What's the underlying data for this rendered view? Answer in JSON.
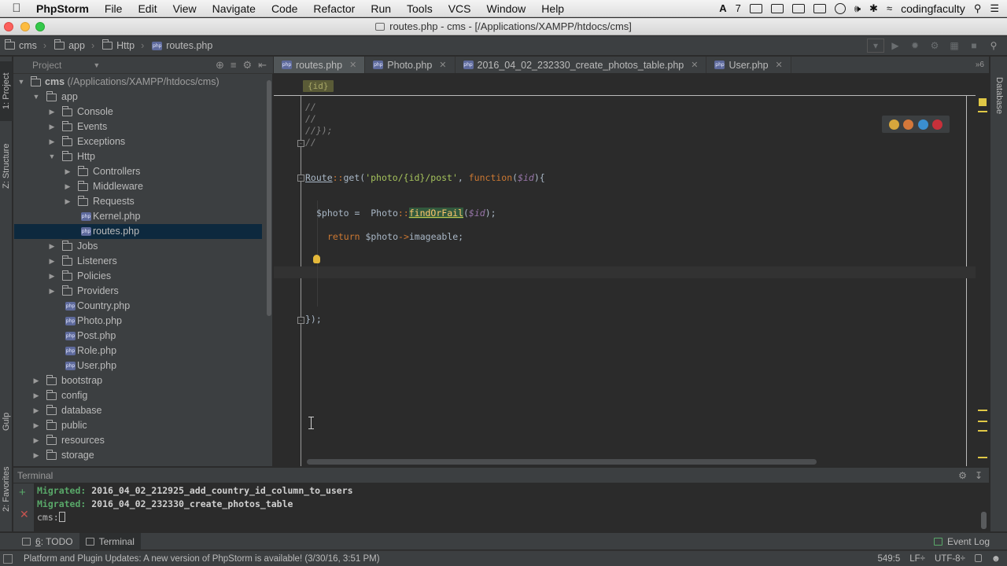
{
  "menubar": {
    "items": [
      "PhpStorm",
      "File",
      "Edit",
      "View",
      "Navigate",
      "Code",
      "Refactor",
      "Run",
      "Tools",
      "VCS",
      "Window",
      "Help"
    ],
    "tray_number": "7",
    "user": "codingfaculty"
  },
  "window": {
    "title": "routes.php - cms - [/Applications/XAMPP/htdocs/cms]"
  },
  "breadcrumb": [
    "cms",
    "app",
    "Http",
    "routes.php"
  ],
  "left_strip": {
    "project": "1: Project",
    "structure": "Z: Structure",
    "gulp": "Gulp",
    "favorites": "2: Favorites"
  },
  "right_strip": {
    "database": "Database"
  },
  "project_panel": {
    "label": "Project",
    "root_name": "cms",
    "root_path": "(/Applications/XAMPP/htdocs/cms)",
    "items": [
      {
        "name": "app"
      },
      {
        "name": "Console"
      },
      {
        "name": "Events"
      },
      {
        "name": "Exceptions"
      },
      {
        "name": "Http"
      },
      {
        "name": "Controllers"
      },
      {
        "name": "Middleware"
      },
      {
        "name": "Requests"
      },
      {
        "name": "Kernel.php"
      },
      {
        "name": "routes.php"
      },
      {
        "name": "Jobs"
      },
      {
        "name": "Listeners"
      },
      {
        "name": "Policies"
      },
      {
        "name": "Providers"
      },
      {
        "name": "Country.php"
      },
      {
        "name": "Photo.php"
      },
      {
        "name": "Post.php"
      },
      {
        "name": "Role.php"
      },
      {
        "name": "User.php"
      },
      {
        "name": "bootstrap"
      },
      {
        "name": "config"
      },
      {
        "name": "database"
      },
      {
        "name": "public"
      },
      {
        "name": "resources"
      },
      {
        "name": "storage"
      }
    ]
  },
  "tabs": [
    {
      "label": "routes.php",
      "active": true
    },
    {
      "label": "Photo.php",
      "active": false
    },
    {
      "label": "2016_04_02_232330_create_photos_table.php",
      "active": false
    },
    {
      "label": "User.php",
      "active": false
    }
  ],
  "tabs_overflow": "»6",
  "editor": {
    "breadcrumb_chip": "{id}",
    "comment_lines": [
      "//",
      "//",
      "//});",
      "//"
    ],
    "route_class": "Route",
    "route_sep": "::",
    "route_method": "get(",
    "route_path": "'photo/{id}/post'",
    "route_comma": ", ",
    "route_function": "function",
    "route_paren_open": "(",
    "route_param": "$id",
    "route_paren_close": "){",
    "line_photo_var": "$photo = ",
    "line_photo_cls": "Photo",
    "line_photo_sep": "::",
    "line_photo_fn": "findOrFail",
    "line_photo_open": "(",
    "line_photo_arg": "$id",
    "line_photo_close": ");",
    "line_return_kw": "return",
    "line_return_var": " $photo",
    "line_return_arrow": "->",
    "line_return_prop": "imageable;",
    "closing": "});"
  },
  "terminal": {
    "header": "Terminal",
    "lines": [
      {
        "prefix": "Migrated:",
        "name": "2016_04_02_212925_add_country_id_column_to_users"
      },
      {
        "prefix": "Migrated:",
        "name": "2016_04_02_232330_create_photos_table"
      }
    ],
    "prompt": "cms:"
  },
  "bottom_tabs": {
    "todo_num": "6",
    "todo": ": TODO",
    "terminal": "Terminal",
    "event_log": "Event Log"
  },
  "status": {
    "message": "Platform and Plugin Updates: A new version of PhpStorm is available! (3/30/16, 3:51 PM)",
    "position": "549:5",
    "line_sep": "LF÷",
    "encoding": "UTF-8÷"
  },
  "colors": {
    "ide_bg": "#2b2b2b",
    "panel_bg": "#3c3f41",
    "selection": "#0d293e",
    "keyword": "#cc7832",
    "string": "#a5c25c",
    "variable": "#9876aa",
    "comment": "#808080"
  }
}
